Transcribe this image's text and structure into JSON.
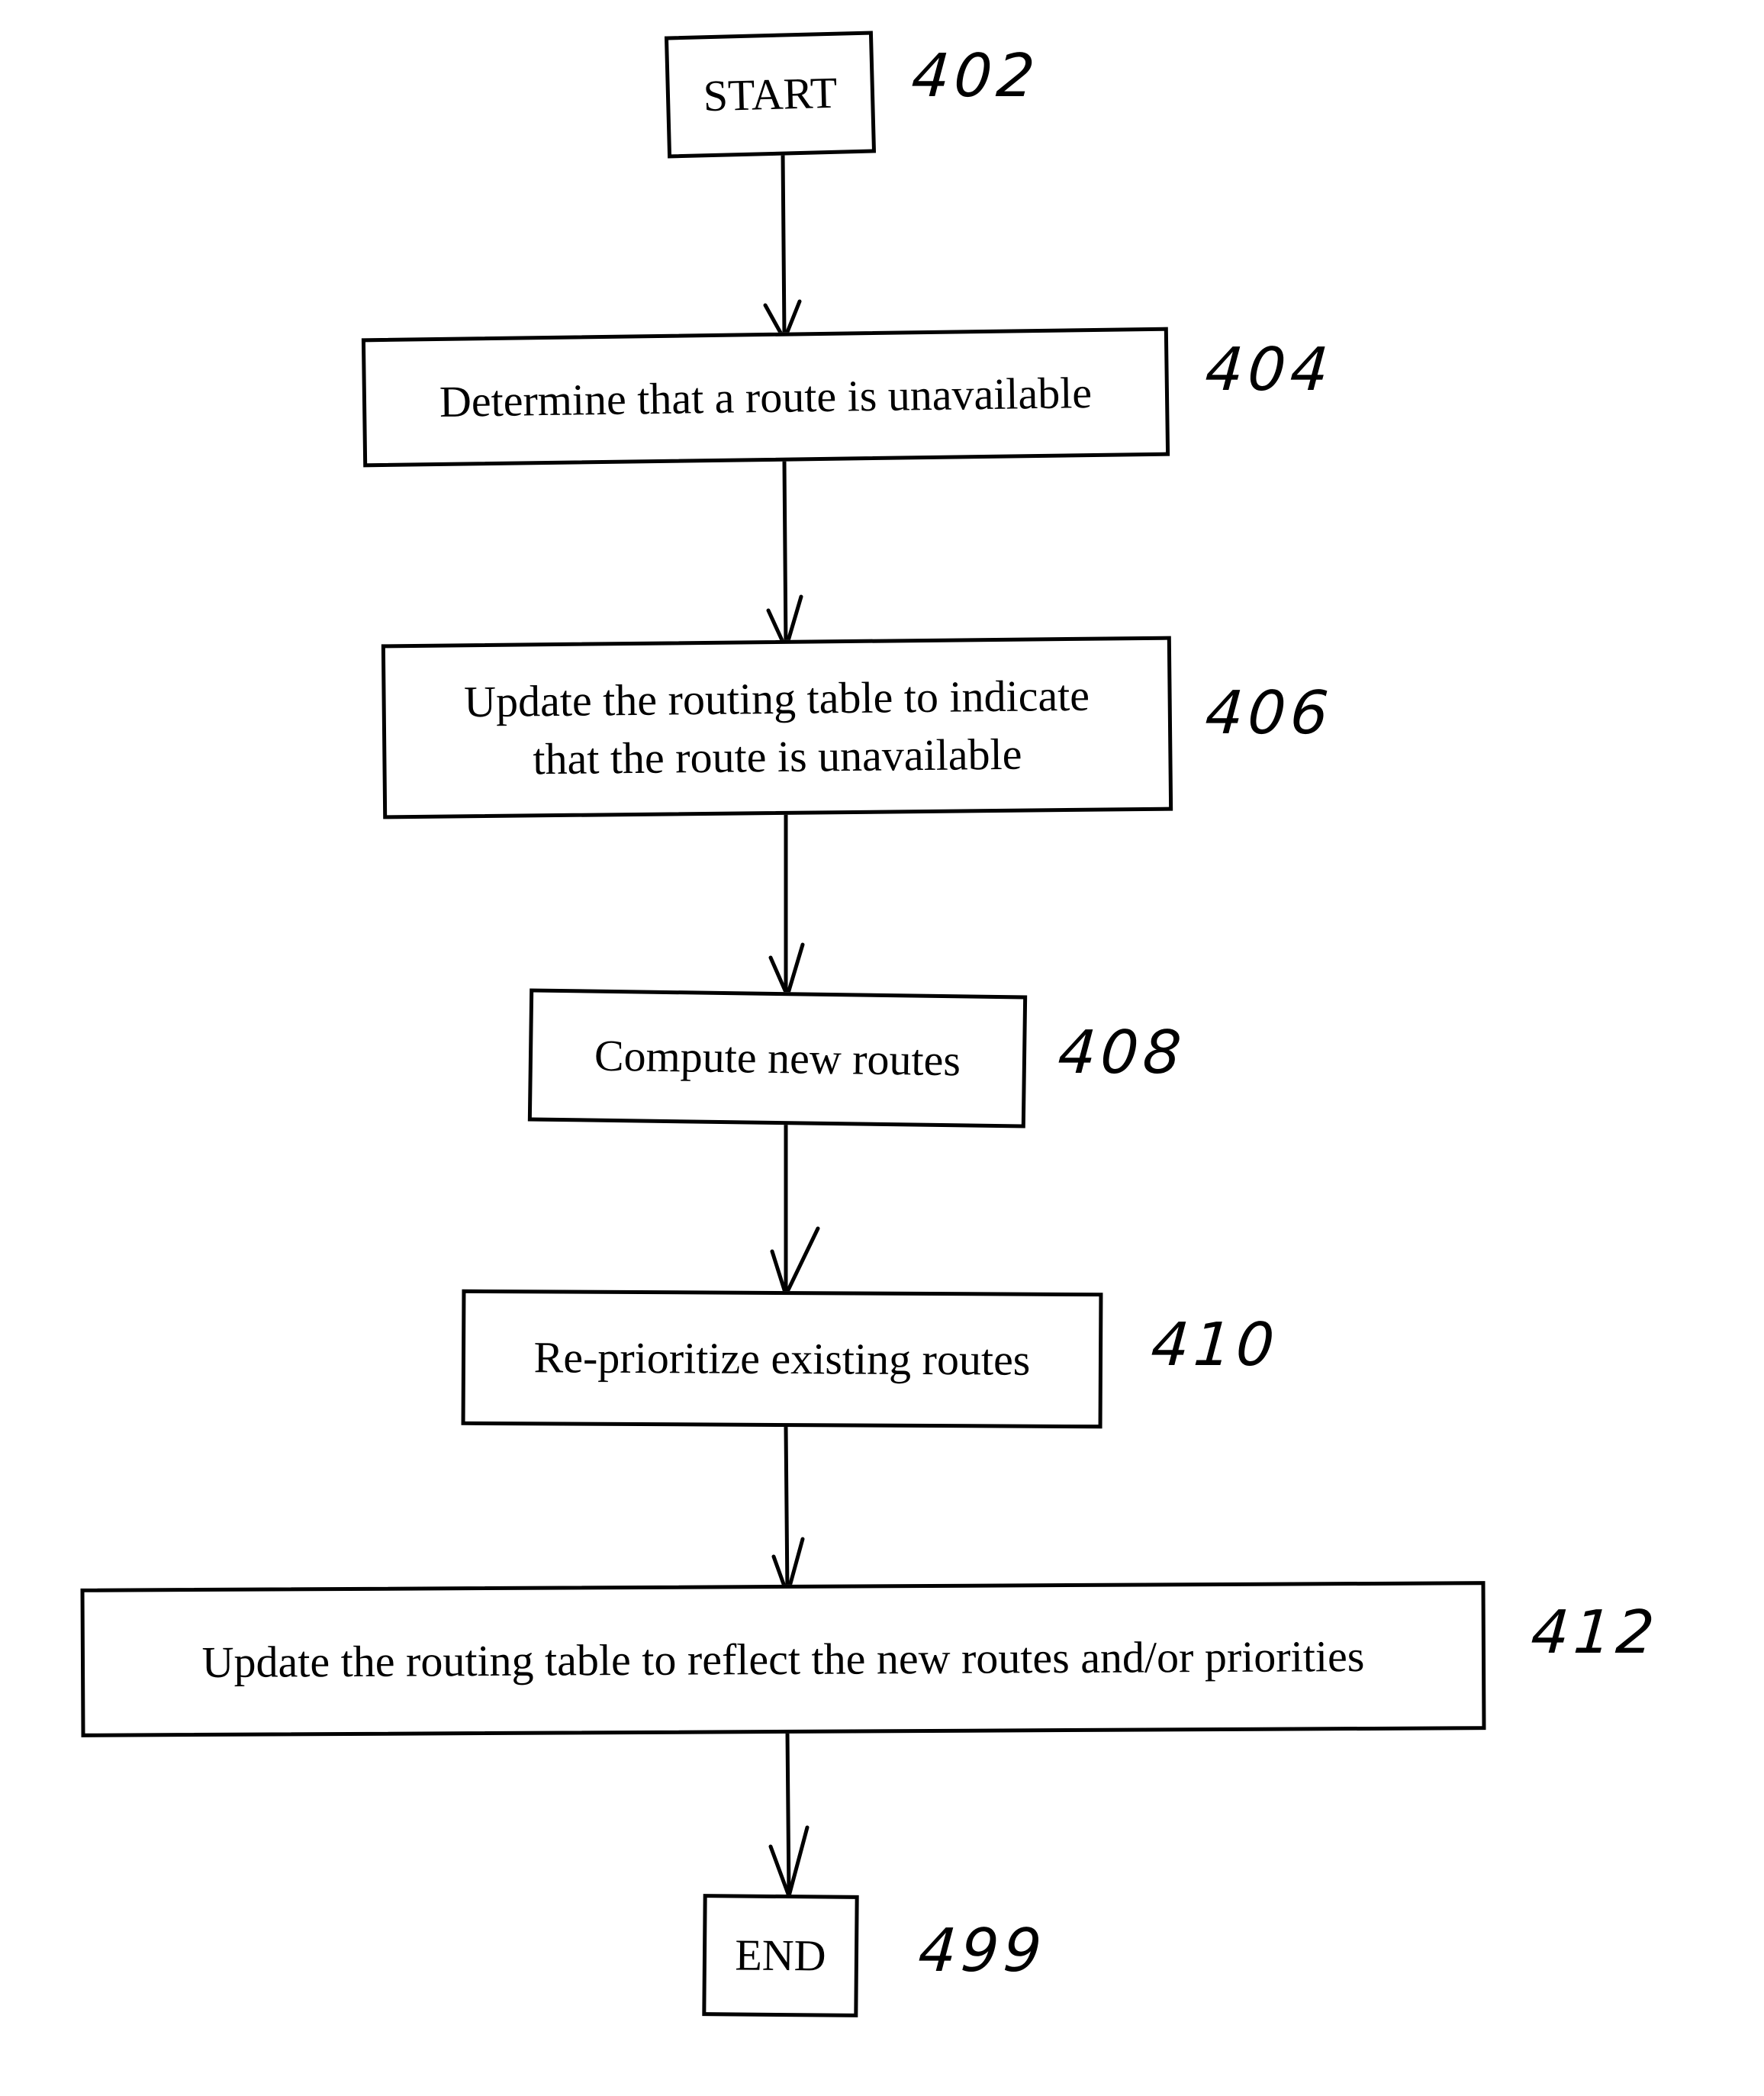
{
  "diagram": {
    "type": "flowchart",
    "nodes": [
      {
        "id": "402",
        "label": "START",
        "ref": "402",
        "kind": "terminal"
      },
      {
        "id": "404",
        "label": "Determine that a route is unavailable",
        "ref": "404",
        "kind": "process"
      },
      {
        "id": "406",
        "label": "Update the routing table to indicate\nthat the route is unavailable",
        "ref": "406",
        "kind": "process"
      },
      {
        "id": "408",
        "label": "Compute new routes",
        "ref": "408",
        "kind": "process"
      },
      {
        "id": "410",
        "label": "Re-prioritize existing routes",
        "ref": "410",
        "kind": "process"
      },
      {
        "id": "412",
        "label": "Update the routing table to reflect the new routes and/or priorities",
        "ref": "412",
        "kind": "process"
      },
      {
        "id": "499",
        "label": "END",
        "ref": "499",
        "kind": "terminal"
      }
    ],
    "edges": [
      {
        "from": "402",
        "to": "404"
      },
      {
        "from": "404",
        "to": "406"
      },
      {
        "from": "406",
        "to": "408"
      },
      {
        "from": "408",
        "to": "410"
      },
      {
        "from": "410",
        "to": "412"
      },
      {
        "from": "412",
        "to": "499"
      }
    ]
  }
}
